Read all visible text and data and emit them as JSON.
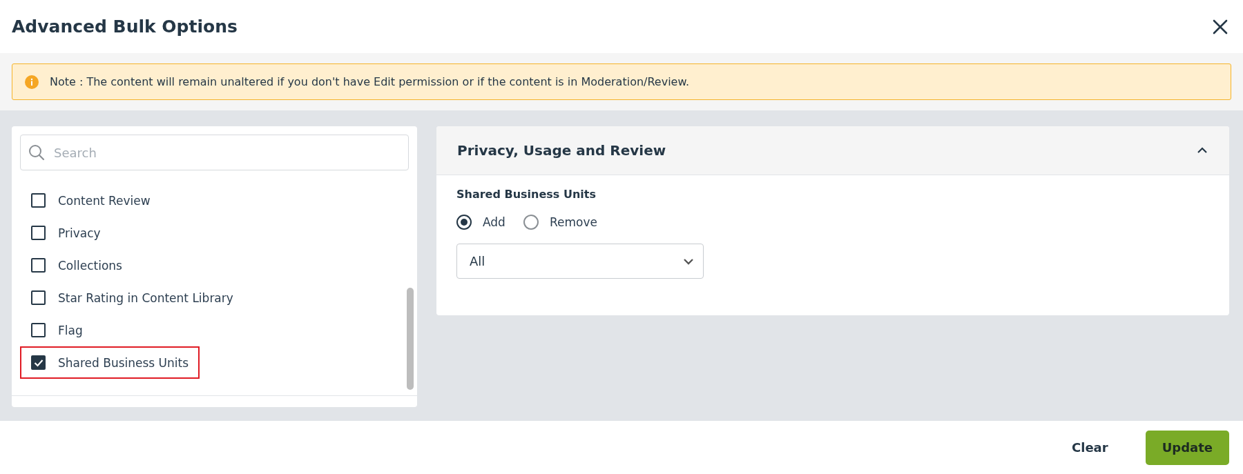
{
  "dialog": {
    "title": "Advanced Bulk Options"
  },
  "note": {
    "text": "Note : The content will remain unaltered if you don't have Edit permission or if the content is in Moderation/Review."
  },
  "search": {
    "placeholder": "Search"
  },
  "options": [
    {
      "label": "Content Review",
      "checked": false,
      "highlighted": false
    },
    {
      "label": "Privacy",
      "checked": false,
      "highlighted": false
    },
    {
      "label": "Collections",
      "checked": false,
      "highlighted": false
    },
    {
      "label": "Star Rating in Content Library",
      "checked": false,
      "highlighted": false
    },
    {
      "label": "Flag",
      "checked": false,
      "highlighted": false
    },
    {
      "label": "Shared Business Units",
      "checked": true,
      "highlighted": true
    }
  ],
  "section": {
    "title": "Privacy, Usage and Review",
    "expanded": true,
    "field_label": "Shared Business Units",
    "radios": [
      {
        "label": "Add",
        "selected": true
      },
      {
        "label": "Remove",
        "selected": false
      }
    ],
    "select": {
      "value": "All"
    }
  },
  "buttons": [
    {
      "label": "Clear",
      "kind": "text"
    },
    {
      "label": "Update",
      "kind": "primary"
    }
  ]
}
